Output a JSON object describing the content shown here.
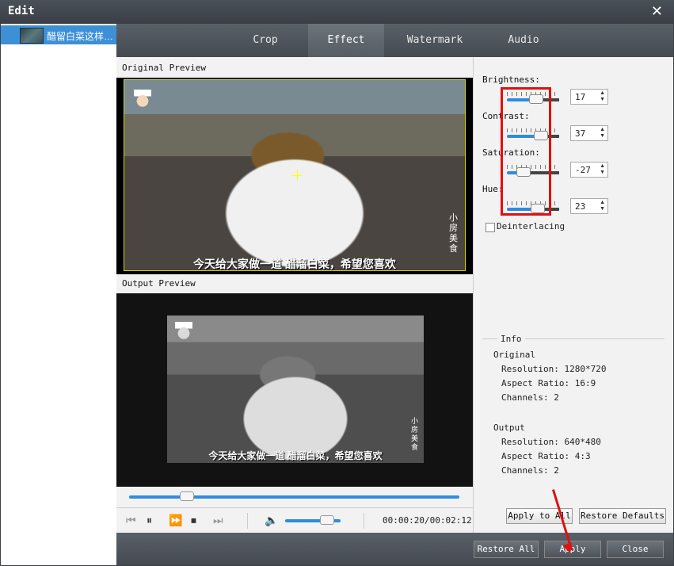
{
  "window": {
    "title": "Edit"
  },
  "file_list": {
    "items": [
      {
        "name": "醋留白菜这样…"
      }
    ]
  },
  "tabs": [
    {
      "label": "Crop"
    },
    {
      "label": "Effect"
    },
    {
      "label": "Watermark"
    },
    {
      "label": "Audio"
    }
  ],
  "preview": {
    "original_label": "Original Preview",
    "output_label": "Output Preview",
    "subtitle": "今天给大家做一道 醋溜白菜，希望您喜欢",
    "watermark": "小房美食",
    "playback_position": 0.16,
    "volume": 0.85,
    "timecode": "00:00:20/00:02:12"
  },
  "settings": {
    "brightness": {
      "label": "Brightness:",
      "value": "17"
    },
    "contrast": {
      "label": "Contrast:",
      "value": "37"
    },
    "saturation": {
      "label": "Saturation:",
      "value": "-27"
    },
    "hue": {
      "label": "Hue:",
      "value": "23"
    },
    "deinterlacing_label": "Deinterlacing",
    "deinterlacing_checked": false
  },
  "info": {
    "title": "Info",
    "original_title": "Original",
    "original_resolution": "Resolution: 1280*720",
    "original_aspect": "Aspect Ratio: 16:9",
    "original_channels": "Channels: 2",
    "output_title": "Output",
    "output_resolution": "Resolution: 640*480",
    "output_aspect": "Aspect Ratio: 4:3",
    "output_channels": "Channels: 2"
  },
  "buttons": {
    "apply_to_all": "Apply to All",
    "restore_defaults": "Restore Defaults",
    "restore_all": "Restore All",
    "apply": "Apply",
    "close": "Close"
  },
  "colors": {
    "accent": "#2f8be0",
    "selection": "#3d8fd6",
    "annotation": "#e01010"
  }
}
